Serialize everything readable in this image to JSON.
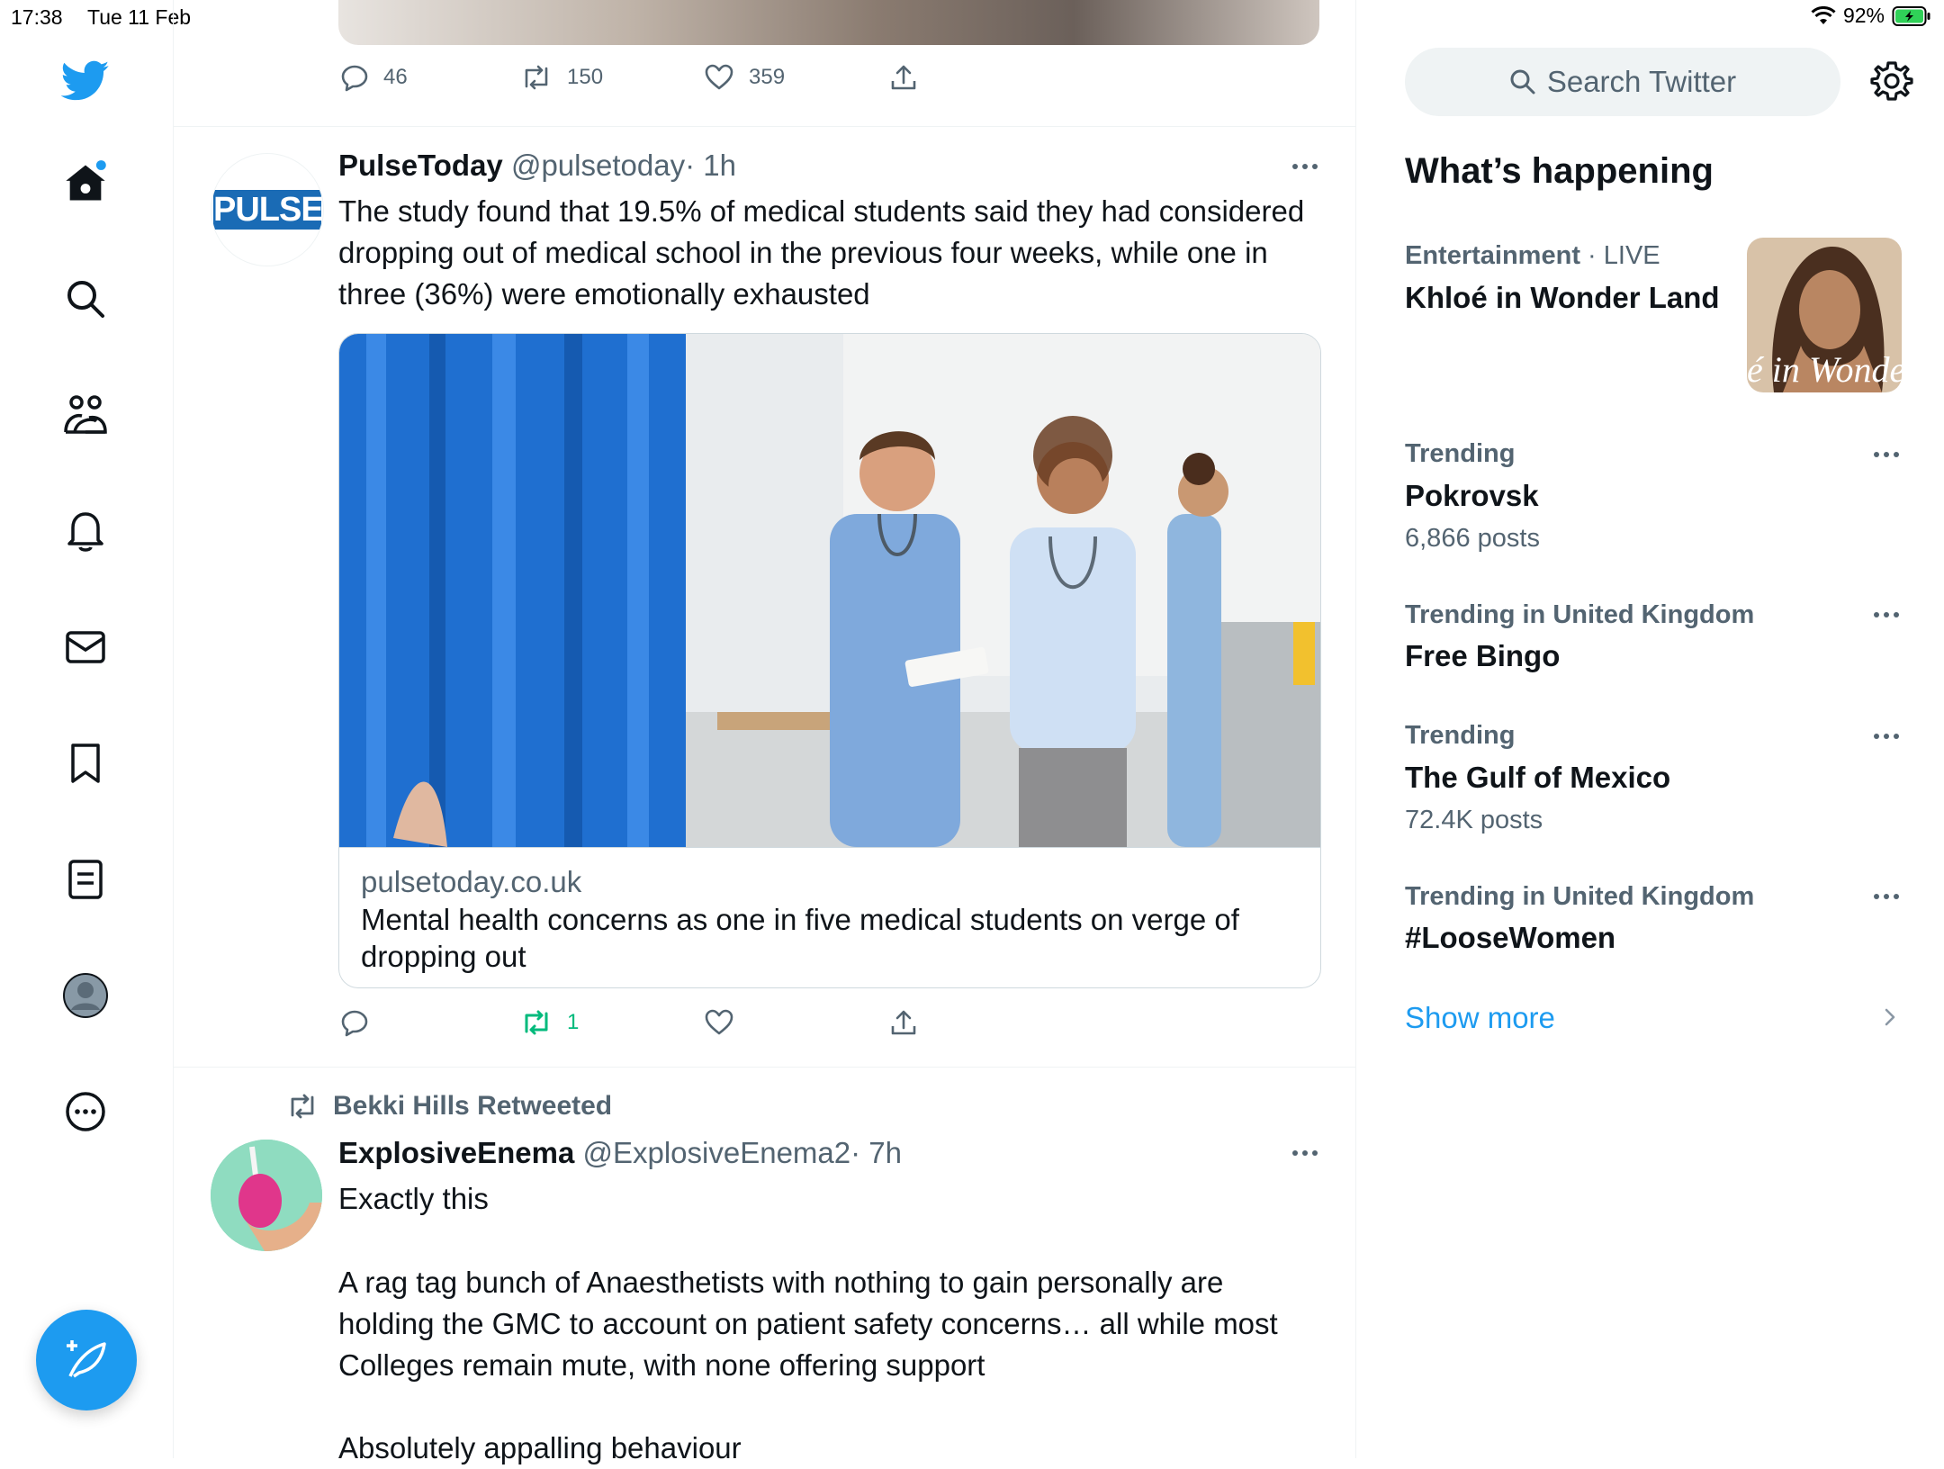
{
  "status_bar": {
    "time": "17:38",
    "date": "Tue 11 Feb",
    "battery": "92%"
  },
  "nav": {
    "items": [
      "twitter-logo",
      "home",
      "explore",
      "communities",
      "notifications",
      "messages",
      "bookmarks",
      "lists",
      "profile",
      "more"
    ],
    "compose_label": "Tweet"
  },
  "previous_tweet": {
    "replies": "46",
    "retweets": "150",
    "likes": "359"
  },
  "tweet1": {
    "name": "PulseToday",
    "handle": "@pulsetoday",
    "time": "· 1h",
    "avatar_text": "PULSE",
    "text": "The study found that 19.5% of medical students said they had considered dropping out of medical school in the previous four weeks, while one in three (36%) were emotionally exhausted",
    "card": {
      "domain": "pulsetoday.co.uk",
      "title": "Mental health concerns as one in five medical students on verge of dropping out"
    },
    "replies": "",
    "retweets": "1",
    "likes": ""
  },
  "tweet2": {
    "retweeted_by": "Bekki Hills Retweeted",
    "name": "ExplosiveEnema",
    "handle": "@ExplosiveEnema2",
    "time": "· 7h",
    "text_1": "Exactly this",
    "text_2": "A rag tag bunch of Anaesthetists with nothing to gain personally are holding the GMC to account on patient safety concerns… all while most Colleges remain mute, with none offering support",
    "text_3": "Absolutely appalling behaviour"
  },
  "sidebar": {
    "search_placeholder": "Search Twitter",
    "title": "What’s happening",
    "trends": [
      {
        "category": "Entertainment",
        "live": "· LIVE",
        "name": "Khloé in Wonder Land",
        "count": "",
        "image_text": "é in Wonder L"
      },
      {
        "category": "Trending",
        "name": "Pokrovsk",
        "count": "6,866 posts"
      },
      {
        "category": "Trending in United Kingdom",
        "name": "Free Bingo",
        "count": ""
      },
      {
        "category": "Trending",
        "name": "The Gulf of Mexico",
        "count": "72.4K posts"
      },
      {
        "category": "Trending in United Kingdom",
        "name": "#LooseWomen",
        "count": ""
      }
    ],
    "show_more": "Show more"
  },
  "colors": {
    "accent": "#1d9bf0",
    "retweet_green": "#00ba7c",
    "secondary_text": "#536471"
  }
}
